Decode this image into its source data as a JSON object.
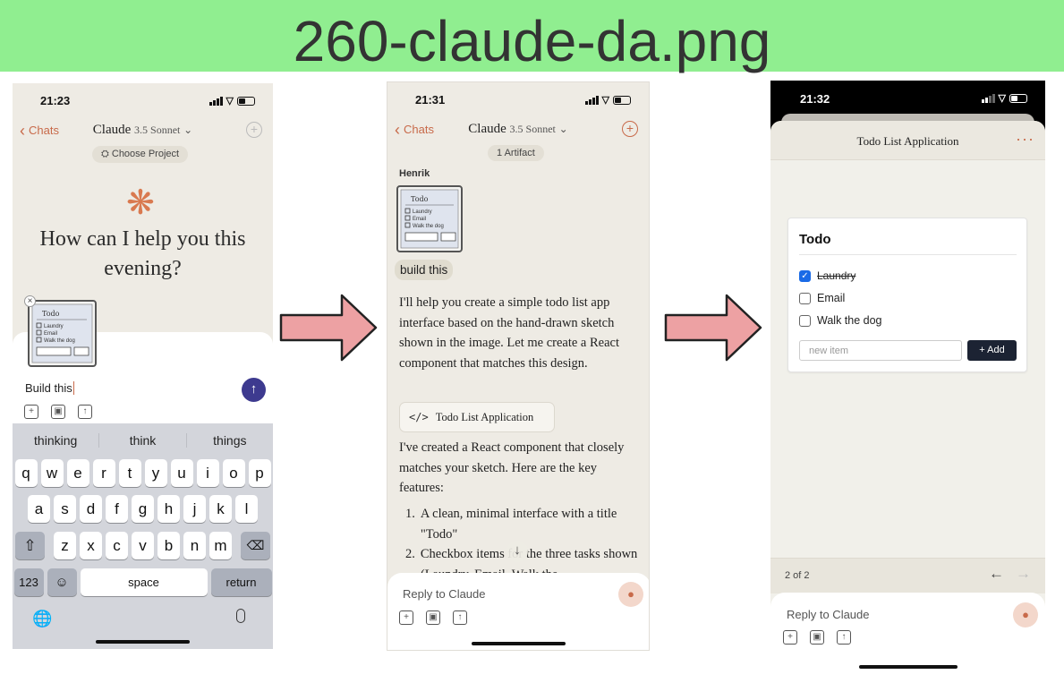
{
  "banner": {
    "title": "260-claude-da.png",
    "color": "#90ee90"
  },
  "screen1": {
    "time": "21:23",
    "back_label": "Chats",
    "app_name": "Claude",
    "model": "3.5 Sonnet",
    "project_label": "Choose Project",
    "greeting": "How can I help you this evening?",
    "input_value": "Build this",
    "suggestions": [
      "thinking",
      "think",
      "things"
    ],
    "keys_row1": [
      "q",
      "w",
      "e",
      "r",
      "t",
      "y",
      "u",
      "i",
      "o",
      "p"
    ],
    "keys_row2": [
      "a",
      "s",
      "d",
      "f",
      "g",
      "h",
      "j",
      "k",
      "l"
    ],
    "keys_row3": [
      "z",
      "x",
      "c",
      "v",
      "b",
      "n",
      "m"
    ],
    "key_123": "123",
    "key_space": "space",
    "key_return": "return"
  },
  "screen2": {
    "time": "21:31",
    "back_label": "Chats",
    "app_name": "Claude",
    "model": "3.5 Sonnet",
    "artifact_count": "1 Artifact",
    "user_name": "Henrik",
    "user_message": "build this",
    "reply_intro": "I'll help you create a simple todo list app interface based on the hand-drawn sketch shown in the image. Let me create a React component that matches this design.",
    "artifact_label": "Todo List Application",
    "reply_followup": "I've created a React component that closely matches your sketch. Here are the key features:",
    "list_items": [
      "A clean, minimal interface with a title \"Todo\"",
      "Checkbox items for the three tasks shown (Laundry, Email, Walk the"
    ],
    "reply_placeholder": "Reply to Claude"
  },
  "screen3": {
    "time": "21:32",
    "artifact_title": "Todo List Application",
    "todo_title": "Todo",
    "todos": [
      {
        "label": "Laundry",
        "done": true
      },
      {
        "label": "Email",
        "done": false
      },
      {
        "label": "Walk the dog",
        "done": false
      }
    ],
    "new_item_placeholder": "new item",
    "add_label": "Add",
    "pager": "2 of 2",
    "reply_placeholder": "Reply to Claude"
  },
  "colors": {
    "accent": "#c86a4a",
    "send_button": "#3d3a8f",
    "add_button": "#1c2333",
    "checkbox": "#1a6ae6"
  },
  "icons": [
    "chevron-left-icon",
    "chevron-down-icon",
    "plus-circle-icon",
    "sparkle-icon",
    "send-arrow-icon",
    "camera-icon",
    "image-icon",
    "upload-icon",
    "mic-icon",
    "code-icon",
    "arrow-left-icon",
    "arrow-right-icon",
    "globe-icon",
    "shift-icon",
    "delete-icon",
    "emoji-icon"
  ]
}
